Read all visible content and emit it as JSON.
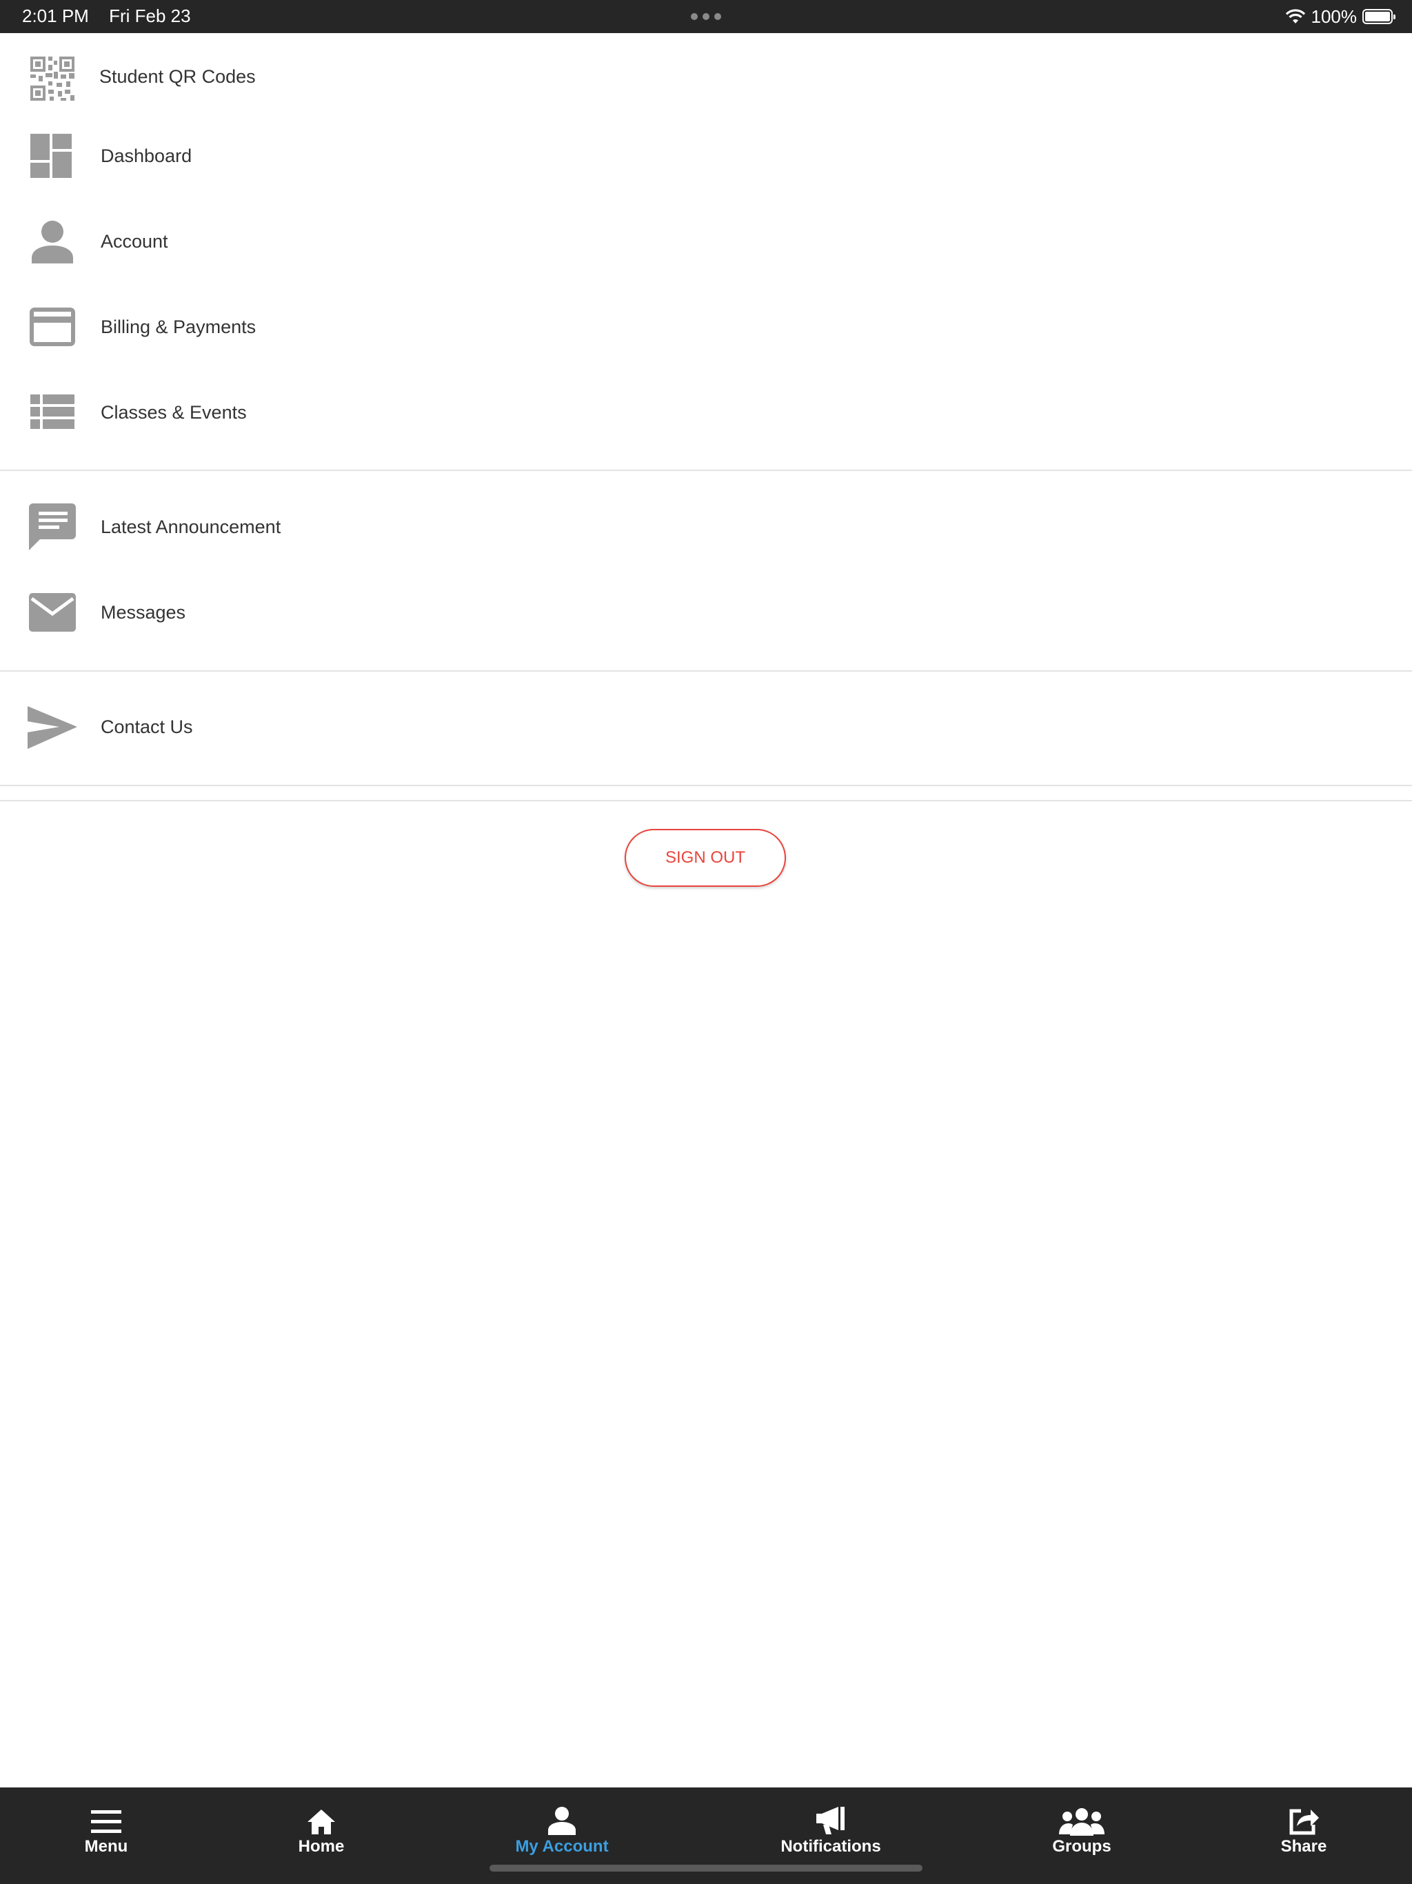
{
  "status_bar": {
    "time": "2:01 PM",
    "date": "Fri Feb 23",
    "battery": "100%",
    "battery_level": 1.0
  },
  "menu": {
    "items": [
      {
        "label": "Student QR Codes",
        "icon": "qr-code-icon"
      },
      {
        "label": "Dashboard",
        "icon": "dashboard-icon"
      },
      {
        "label": "Account",
        "icon": "person-icon"
      },
      {
        "label": "Billing & Payments",
        "icon": "credit-card-icon"
      },
      {
        "label": "Classes & Events",
        "icon": "list-icon"
      },
      {
        "label": "Latest Announcement",
        "icon": "chat-bubble-icon"
      },
      {
        "label": "Messages",
        "icon": "envelope-icon"
      },
      {
        "label": "Contact Us",
        "icon": "send-icon"
      }
    ]
  },
  "signout_label": "SIGN OUT",
  "tabs": [
    {
      "label": "Menu",
      "icon": "hamburger-icon"
    },
    {
      "label": "Home",
      "icon": "home-icon"
    },
    {
      "label": "My Account",
      "icon": "person-icon",
      "active": true
    },
    {
      "label": "Notifications",
      "icon": "megaphone-icon"
    },
    {
      "label": "Groups",
      "icon": "group-icon"
    },
    {
      "label": "Share",
      "icon": "share-icon"
    }
  ],
  "colors": {
    "accent_active": "#3b9fe0",
    "signout_red": "#e8453c",
    "icon_gray": "#9b9b9b",
    "bar_dark": "#262626"
  }
}
